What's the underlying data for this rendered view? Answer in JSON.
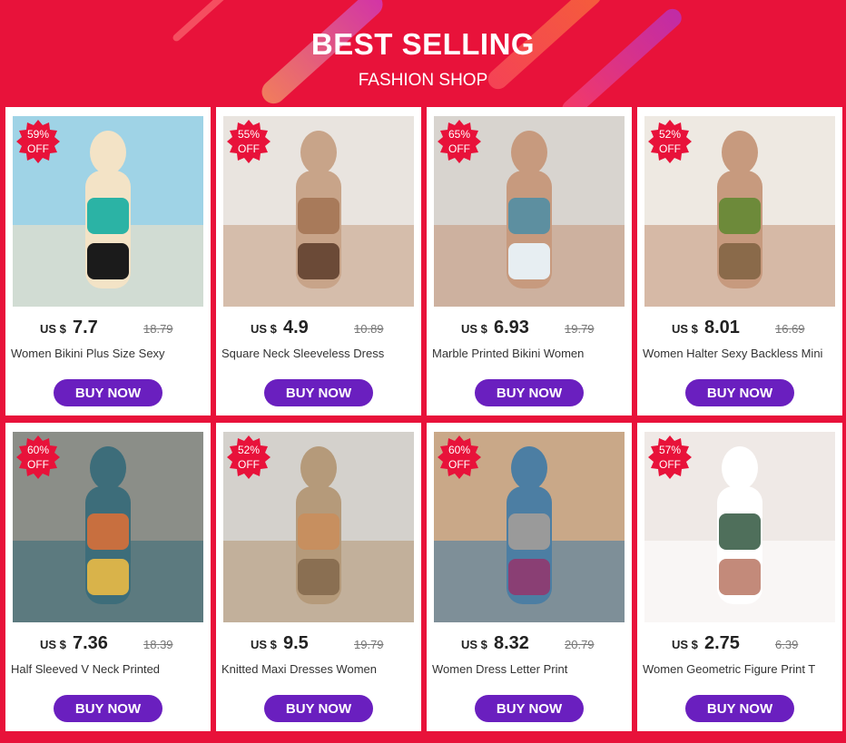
{
  "header": {
    "title": "BEST SELLING",
    "subtitle": "FASHION SHOP"
  },
  "colors": {
    "background": "#e8123a",
    "button": "#6a1fbf",
    "badge": "#e8123a"
  },
  "products": [
    {
      "discount": "59%",
      "off": "OFF",
      "currency": "US $",
      "price": "7.7",
      "old_price": "18.79",
      "name": "Women Bikini     Plus Size Sexy",
      "button": "BUY NOW",
      "palette": [
        "#9fd3e6",
        "#f3e3c6",
        "#2bb3a5",
        "#1b1b1b"
      ]
    },
    {
      "discount": "55%",
      "off": "OFF",
      "currency": "US $",
      "price": "4.9",
      "old_price": "10.89",
      "name": "Square Neck Sleeveless Dress",
      "button": "BUY NOW",
      "palette": [
        "#e9e4df",
        "#c8a489",
        "#a87a5a",
        "#6b4a37"
      ]
    },
    {
      "discount": "65%",
      "off": "OFF",
      "currency": "US $",
      "price": "6.93",
      "old_price": "19.79",
      "name": "Marble Printed Bikini Women",
      "button": "BUY NOW",
      "palette": [
        "#d8d4cf",
        "#c79a7e",
        "#5d8fa0",
        "#e7eef2"
      ]
    },
    {
      "discount": "52%",
      "off": "OFF",
      "currency": "US $",
      "price": "8.01",
      "old_price": "16.69",
      "name": "Women Halter     Sexy Backless Mini",
      "button": "BUY NOW",
      "palette": [
        "#eee9e2",
        "#c79a7e",
        "#6d8a3a",
        "#8a6a4a"
      ]
    },
    {
      "discount": "60%",
      "off": "OFF",
      "currency": "US $",
      "price": "7.36",
      "old_price": "18.39",
      "name": "Half Sleeved V Neck Printed",
      "button": "BUY NOW",
      "palette": [
        "#8b8e88",
        "#3d6d7a",
        "#c86f3f",
        "#d9b34a"
      ]
    },
    {
      "discount": "52%",
      "off": "OFF",
      "currency": "US $",
      "price": "9.5",
      "old_price": "19.79",
      "name": "Knitted Maxi Dresses  Women",
      "button": "BUY NOW",
      "palette": [
        "#d4d1cc",
        "#b59a7a",
        "#c78f5f",
        "#8a6f52"
      ]
    },
    {
      "discount": "60%",
      "off": "OFF",
      "currency": "US $",
      "price": "8.32",
      "old_price": "20.79",
      "name": "Women Dress  Letter Print",
      "button": "BUY NOW",
      "palette": [
        "#c9a888",
        "#4c7ea3",
        "#9a9a9a",
        "#8a3f74"
      ]
    },
    {
      "discount": "57%",
      "off": "OFF",
      "currency": "US $",
      "price": "2.75",
      "old_price": "6.39",
      "name": "Women  Geometric Figure Print T",
      "button": "BUY NOW",
      "palette": [
        "#efe9e6",
        "#ffffff",
        "#4f6f5b",
        "#c38a7a"
      ]
    }
  ]
}
